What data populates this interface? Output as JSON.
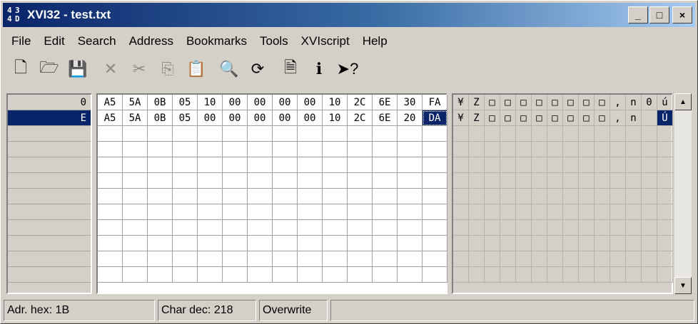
{
  "window": {
    "title": "XVI32 - test.txt",
    "icon_name": "app-grid-icon",
    "icon_glyphs": [
      "4",
      "3",
      "4",
      "D"
    ]
  },
  "titlebar_buttons": {
    "minimize": "_",
    "maximize": "□",
    "close": "×"
  },
  "menu": [
    {
      "label": "File"
    },
    {
      "label": "Edit"
    },
    {
      "label": "Search"
    },
    {
      "label": "Address"
    },
    {
      "label": "Bookmarks"
    },
    {
      "label": "Tools"
    },
    {
      "label": "XVIscript"
    },
    {
      "label": "Help"
    }
  ],
  "toolbar": [
    {
      "name": "new-icon",
      "glyph": "🗋",
      "enabled": true
    },
    {
      "name": "open-icon",
      "glyph": "🗁",
      "enabled": true
    },
    {
      "name": "save-icon",
      "glyph": "💾",
      "enabled": true
    },
    {
      "name": "delete-icon",
      "glyph": "✕",
      "enabled": false
    },
    {
      "name": "cut-icon",
      "glyph": "✂",
      "enabled": false
    },
    {
      "name": "copy-icon",
      "glyph": "⎘",
      "enabled": false
    },
    {
      "name": "paste-icon",
      "glyph": "📋",
      "enabled": false
    },
    {
      "name": "find-icon",
      "glyph": "🔍",
      "enabled": true
    },
    {
      "name": "replace-icon",
      "glyph": "⟳",
      "enabled": true
    },
    {
      "name": "properties-icon",
      "glyph": "🗎",
      "enabled": true
    },
    {
      "name": "info-icon",
      "glyph": "ℹ",
      "enabled": true
    },
    {
      "name": "help-pointer-icon",
      "glyph": "➤?",
      "enabled": true
    }
  ],
  "rows": [
    {
      "address": "0",
      "hex": [
        "A5",
        "5A",
        "0B",
        "05",
        "10",
        "00",
        "00",
        "00",
        "00",
        "10",
        "2C",
        "6E",
        "30",
        "FA"
      ],
      "chars": [
        "¥",
        "Z",
        "□",
        "□",
        "□",
        "□",
        "□",
        "□",
        "□",
        "□",
        ",",
        "n",
        "0",
        "ú"
      ]
    },
    {
      "address": "E",
      "hex": [
        "A5",
        "5A",
        "0B",
        "05",
        "00",
        "00",
        "00",
        "00",
        "00",
        "10",
        "2C",
        "6E",
        "20",
        "DA"
      ],
      "chars": [
        "¥",
        "Z",
        "□",
        "□",
        "□",
        "□",
        "□",
        "□",
        "□",
        "□",
        ",",
        "n",
        " ",
        "Ú"
      ]
    }
  ],
  "cursor": {
    "row": 1,
    "col": 13
  },
  "status": {
    "address": "Adr. hex: 1B",
    "char": "Char dec: 218",
    "mode": "Overwrite",
    "extra": ""
  }
}
